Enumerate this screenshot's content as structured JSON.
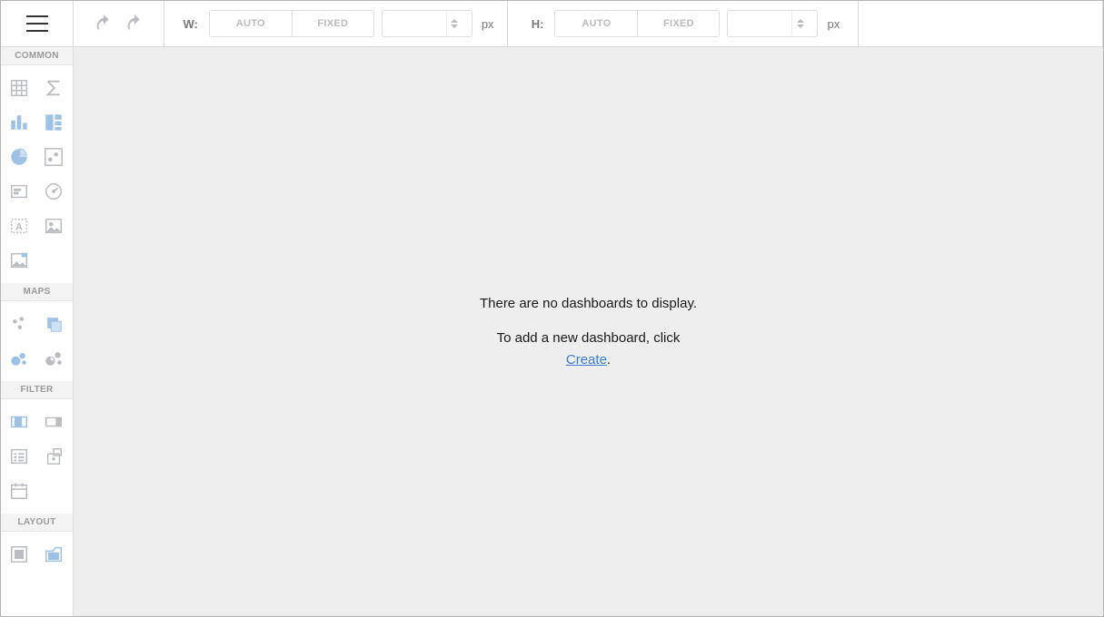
{
  "toolbar": {
    "width": {
      "label": "W:",
      "auto": "AUTO",
      "fixed": "FIXED",
      "value": "",
      "unit": "px"
    },
    "height": {
      "label": "H:",
      "auto": "AUTO",
      "fixed": "FIXED",
      "value": "",
      "unit": "px"
    }
  },
  "sidebar": {
    "sections": {
      "common": "COMMON",
      "maps": "MAPS",
      "filter": "FILTER",
      "layout": "LAYOUT"
    }
  },
  "canvas": {
    "empty_line1": "There are no dashboards to display.",
    "empty_line2": "To add a new dashboard, click ",
    "create_link": "Create",
    "period": "."
  }
}
